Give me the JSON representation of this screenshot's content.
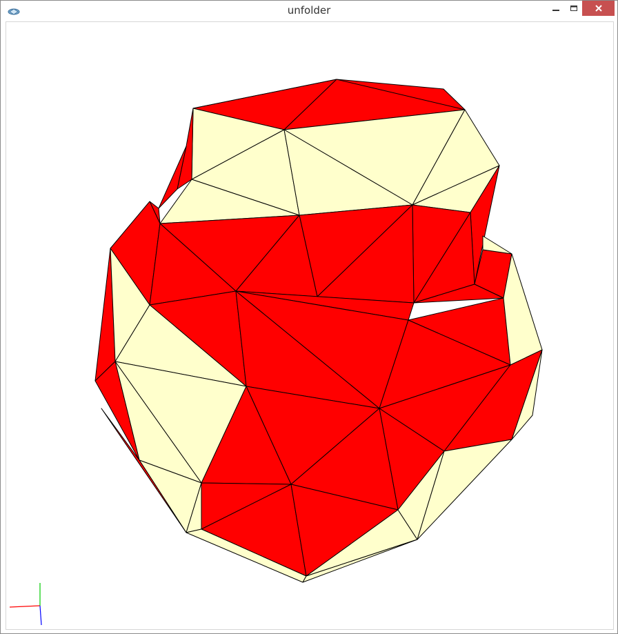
{
  "window": {
    "title": "unfolder",
    "app_icon": "unfolder-app-icon",
    "controls": [
      "minimize-icon",
      "maximize-icon",
      "close-icon"
    ]
  },
  "viewport": {
    "background": "#ffffff",
    "face_colors": {
      "unfolded": "#ff0000",
      "folded": "#ffffcc",
      "edge": "#000000"
    },
    "axes_gizmo": {
      "x_color": "#ff0000",
      "y_color": "#00cc00",
      "z_color": "#0000ff"
    }
  }
}
